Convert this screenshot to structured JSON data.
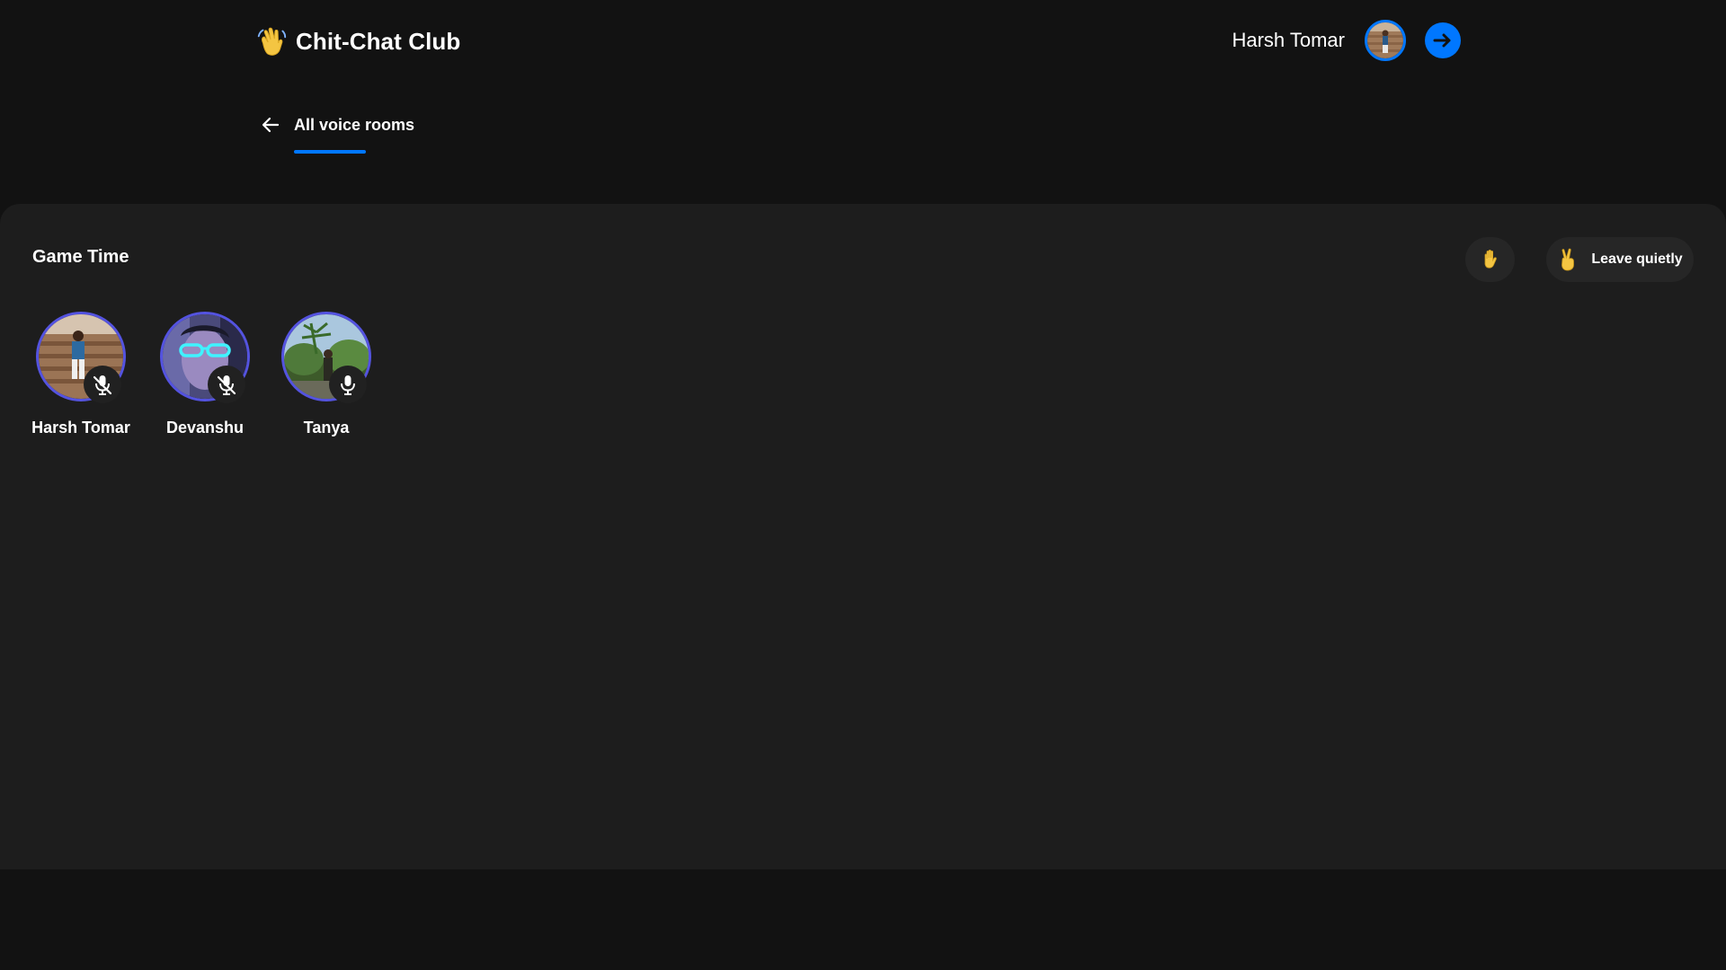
{
  "app": {
    "title": "Chit-Chat Club",
    "logo_icon": "waving-hand-icon"
  },
  "user": {
    "name": "Harsh Tomar",
    "avatar_icon": "user-avatar",
    "logout_icon": "arrow-right-icon"
  },
  "nav": {
    "back_icon": "arrow-left-icon",
    "label": "All voice rooms"
  },
  "room": {
    "title": "Game Time",
    "raise_hand_icon": "raised-hand-icon",
    "leave_icon": "victory-hand-icon",
    "leave_label": "Leave quietly",
    "participants": [
      {
        "name": "Harsh Tomar",
        "muted": true
      },
      {
        "name": "Devanshu",
        "muted": true
      },
      {
        "name": "Tanya",
        "muted": false
      }
    ]
  },
  "colors": {
    "accent": "#0077ff",
    "avatar_ring": "#5453e0",
    "background": "#121212",
    "panel": "#1d1d1d"
  }
}
